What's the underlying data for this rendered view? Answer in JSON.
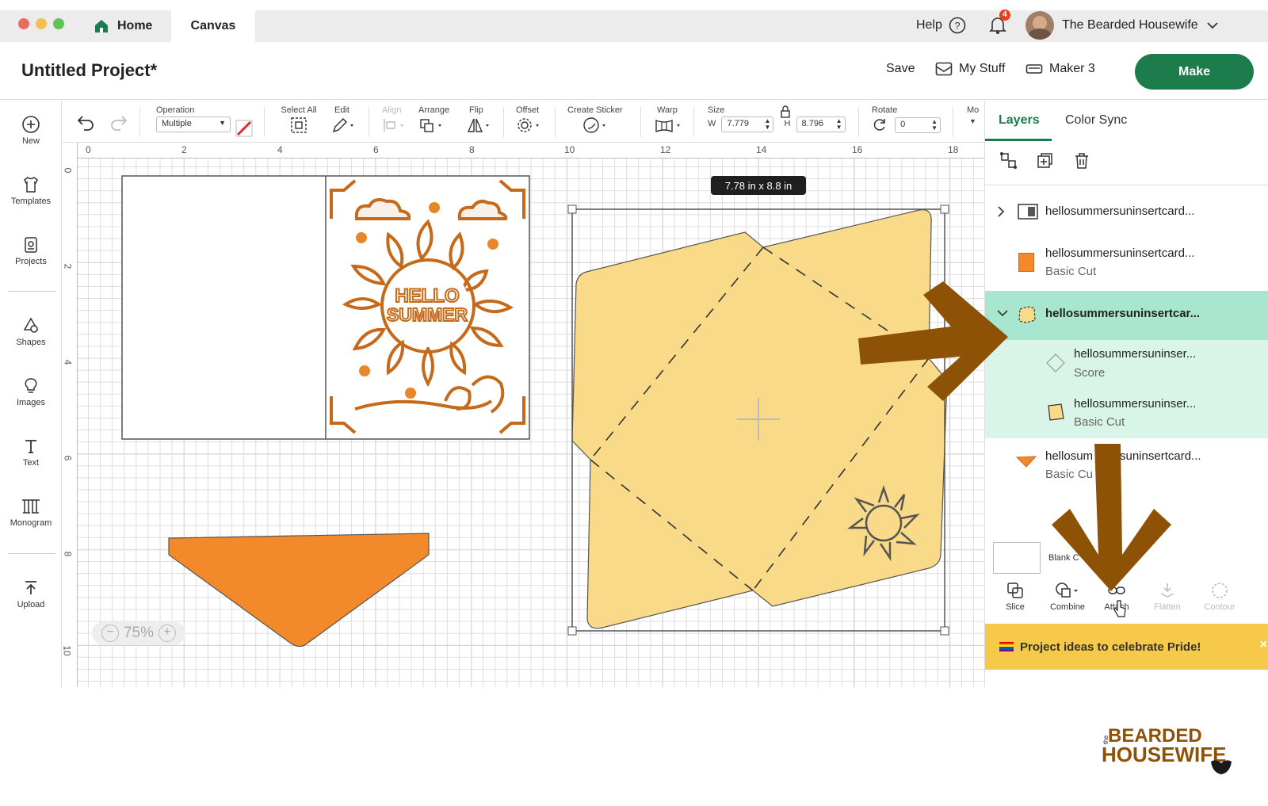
{
  "window": {
    "tabs": [
      {
        "label": "Home"
      },
      {
        "label": "Canvas"
      }
    ],
    "help_label": "Help",
    "notification_count": "4",
    "user_name": "The Bearded Housewife"
  },
  "project": {
    "title": "Untitled Project*",
    "save_label": "Save",
    "mystuff_label": "My Stuff",
    "machine_label": "Maker 3",
    "make_label": "Make"
  },
  "sidebar": {
    "items": [
      {
        "label": "New",
        "icon": "plus-circle-icon"
      },
      {
        "label": "Templates",
        "icon": "shirt-icon"
      },
      {
        "label": "Projects",
        "icon": "projects-icon"
      },
      {
        "label": "Shapes",
        "icon": "shapes-icon"
      },
      {
        "label": "Images",
        "icon": "lightbulb-icon"
      },
      {
        "label": "Text",
        "icon": "text-icon"
      },
      {
        "label": "Monogram",
        "icon": "monogram-icon"
      },
      {
        "label": "Upload",
        "icon": "upload-icon"
      }
    ]
  },
  "toolbar": {
    "operation_label": "Operation",
    "operation_value": "Multiple",
    "select_all_label": "Select All",
    "edit_label": "Edit",
    "align_label": "Align",
    "arrange_label": "Arrange",
    "flip_label": "Flip",
    "offset_label": "Offset",
    "create_sticker_label": "Create Sticker",
    "warp_label": "Warp",
    "size_label": "Size",
    "w_label": "W",
    "w_value": "7.779",
    "h_label": "H",
    "h_value": "8.796",
    "rotate_label": "Rotate",
    "rotate_value": "0",
    "more_label": "Mo"
  },
  "canvas": {
    "ruler_top": [
      "0",
      "2",
      "4",
      "6",
      "8",
      "10",
      "12",
      "14",
      "16",
      "18"
    ],
    "ruler_left": [
      "0",
      "2",
      "4",
      "6",
      "8",
      "10"
    ],
    "dimension_tooltip": "7.78  in x 8.8  in",
    "zoom_level": "75%",
    "card_text_line1": "HELLO",
    "card_text_line2": "SUMMER",
    "colors": {
      "orange": "#f28a2c",
      "envelope": "#f9da88",
      "sun": "#c56a1a"
    }
  },
  "layers_panel": {
    "tabs": [
      {
        "label": "Layers"
      },
      {
        "label": "Color Sync"
      }
    ],
    "layers": [
      {
        "name": "hellosummersuninsertcard...",
        "sub": ""
      },
      {
        "name": "hellosummersuninsertcard...",
        "sub": "Basic Cut"
      },
      {
        "name": "hellosummersuninsertcar...",
        "sub": ""
      },
      {
        "name": "hellosummersuninser...",
        "sub": "Score"
      },
      {
        "name": "hellosummersuninser...",
        "sub": "Basic Cut"
      },
      {
        "name": "hellosum",
        "name2": "suninsertcard...",
        "sub": "Basic Cu"
      }
    ],
    "blank_label": "Blank C",
    "tools": [
      {
        "label": "Slice",
        "enabled": true
      },
      {
        "label": "Combine",
        "enabled": true
      },
      {
        "label": "Attach",
        "enabled": true
      },
      {
        "label": "Flatten",
        "enabled": false
      },
      {
        "label": "Contour",
        "enabled": false
      }
    ],
    "banner_text": "Project ideas to celebrate Pride!"
  },
  "watermark": {
    "line1": "BEARDED",
    "line2": "HOUSEWIFE",
    "small": "the"
  }
}
